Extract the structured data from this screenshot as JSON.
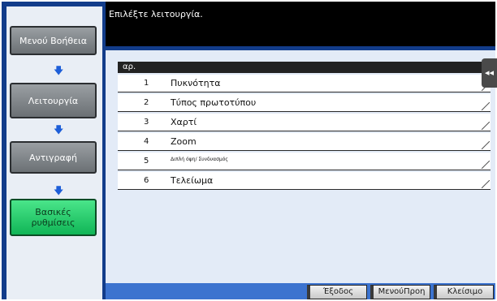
{
  "message": "Επιλέξτε λειτουργία.",
  "nav": {
    "help_menu": "Μενού Βοήθεια",
    "function": "Λειτουργία",
    "copy": "Αντιγραφή",
    "basic_settings_line1": "Βασικές",
    "basic_settings_line2": "ρυθμίσεις"
  },
  "table": {
    "header": "αρ.",
    "rows": [
      {
        "num": "1",
        "label": "Πυκνότητα"
      },
      {
        "num": "2",
        "label": "Τύπος πρωτοτύπου"
      },
      {
        "num": "3",
        "label": "Χαρτί"
      },
      {
        "num": "4",
        "label": "Zoom"
      },
      {
        "num": "5",
        "label": "Διπλή όψη/ Συνδυασμός"
      },
      {
        "num": "6",
        "label": "Τελείωμα"
      }
    ]
  },
  "side_tab": "◂◂",
  "bottom": {
    "exit": "Έξοδος",
    "menu_prev": "ΜενούΠροη",
    "close": "Κλείσιμο"
  },
  "colors": {
    "frame": "#123c8a",
    "active_nav": "#22c96a",
    "bottom_bar": "#3c73cf"
  }
}
